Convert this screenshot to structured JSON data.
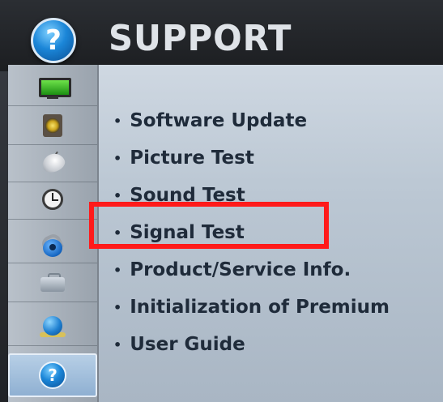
{
  "header": {
    "title": "SUPPORT",
    "icon": "help-icon",
    "icon_glyph": "?"
  },
  "sidebar": {
    "items": [
      {
        "name": "tv-icon",
        "label": ""
      },
      {
        "name": "speaker-icon",
        "label": ""
      },
      {
        "name": "satellite-dish-icon",
        "label": ""
      },
      {
        "name": "clock-icon",
        "label": ""
      },
      {
        "name": "lock-icon",
        "label": ""
      },
      {
        "name": "toolbox-icon",
        "label": ""
      },
      {
        "name": "network-globe-icon",
        "label": ""
      },
      {
        "name": "help-icon",
        "label": "?",
        "active": true
      }
    ]
  },
  "menu": {
    "bullet": "•",
    "items": [
      {
        "label": "Software Update"
      },
      {
        "label": "Picture Test"
      },
      {
        "label": "Sound Test"
      },
      {
        "label": "Signal Test",
        "highlighted": true
      },
      {
        "label": "Product/Service Info."
      },
      {
        "label": "Initialization of Premium"
      },
      {
        "label": "User Guide"
      }
    ]
  },
  "colors": {
    "highlight_border": "#ff1a1a",
    "panel_bg": "#bcc8d4",
    "text": "#1f2b3a",
    "accent_blue": "#1b86d8"
  }
}
